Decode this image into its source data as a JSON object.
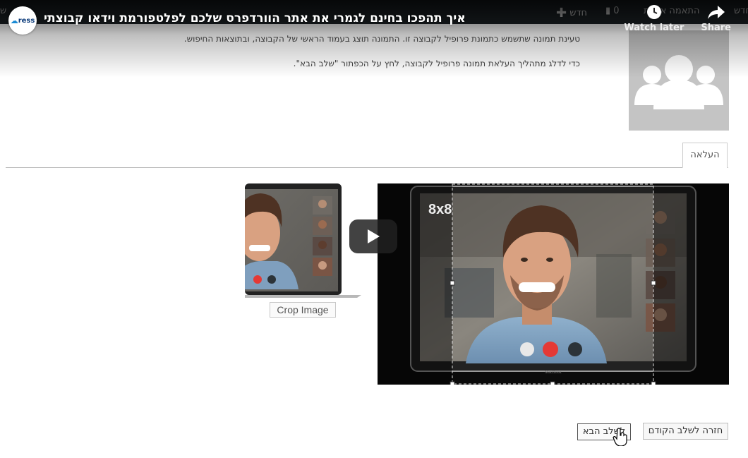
{
  "adminbar": {
    "left_char": "ש",
    "right_label": "חדש",
    "customize_label": "התאמה אישית",
    "comments_count": "0",
    "new_label": "חדש"
  },
  "video": {
    "title": "איך תהפכו בחינם לגמרי את אתר הוורדפרס שלכם לפלטפורמת וידאו קבוצתי",
    "channel_logo_text": "ress",
    "watch_later_label": "Watch later",
    "share_label": "Share",
    "play_icon": "play-icon"
  },
  "description": {
    "line1": "טעינת תמונה שתשמש כתמונת פרופיל לקבוצה זו. התמונה תוצג בעמוד הראשי של הקבוצה, ובתוצאות החיפוש.",
    "line2": "כדי לדלג מתהליך העלאת תמונה פרופיל לקבוצה, לחץ על הכפתור \"שלב הבא\"."
  },
  "tabs": {
    "upload_label": "העלאה"
  },
  "crop": {
    "overlay_text": "8x8",
    "button_label": "Crop Image",
    "laptop_brand": "MacBook"
  },
  "footer": {
    "prev_label": "חזרה לשלב הקודם",
    "next_label": "לשלב הבא"
  },
  "colors": {
    "adminbar_bg": "#1d2327",
    "avatar_bg": "#c4c4c4",
    "end_call_red": "#e53935"
  }
}
